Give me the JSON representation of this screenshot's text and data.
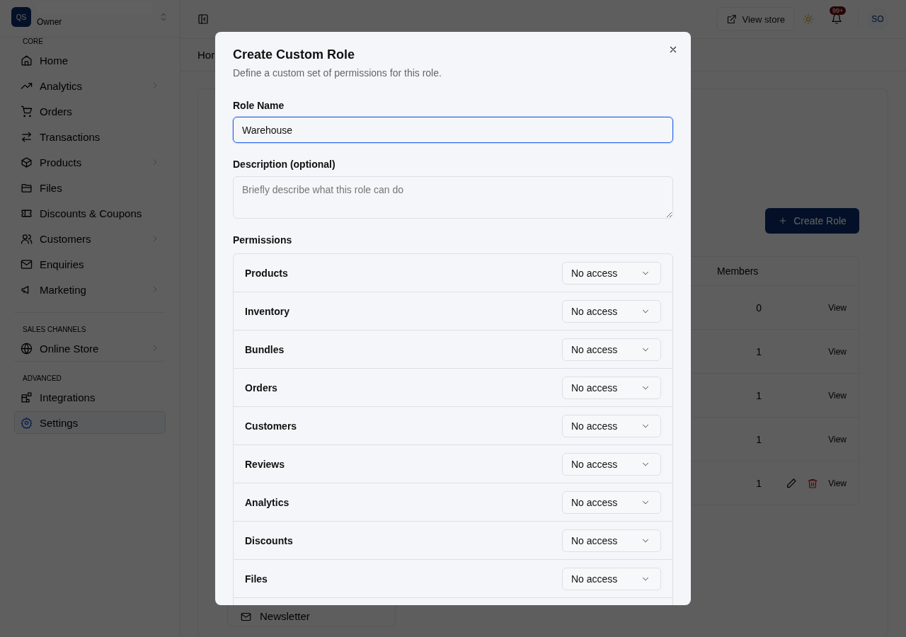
{
  "sidebar": {
    "brand": {
      "initials": "QS",
      "role": "Owner"
    },
    "sections": [
      {
        "label": "CORE",
        "items": [
          {
            "label": "Home",
            "has_children": false,
            "selected": false
          },
          {
            "label": "Analytics",
            "has_children": true,
            "selected": false
          },
          {
            "label": "Orders",
            "has_children": false,
            "selected": false
          },
          {
            "label": "Transactions",
            "has_children": false,
            "selected": false
          },
          {
            "label": "Products",
            "has_children": true,
            "selected": false
          },
          {
            "label": "Files",
            "has_children": false,
            "selected": false
          },
          {
            "label": "Discounts & Coupons",
            "has_children": false,
            "selected": false
          },
          {
            "label": "Customers",
            "has_children": true,
            "selected": false
          },
          {
            "label": "Enquiries",
            "has_children": false,
            "selected": false
          },
          {
            "label": "Marketing",
            "has_children": true,
            "selected": false
          }
        ]
      },
      {
        "label": "SALES CHANNELS",
        "items": [
          {
            "label": "Online Store",
            "has_children": true,
            "selected": false
          }
        ]
      },
      {
        "label": "ADVANCED",
        "items": [
          {
            "label": "Integrations",
            "has_children": false,
            "selected": false
          },
          {
            "label": "Settings",
            "has_children": false,
            "selected": true
          }
        ]
      }
    ]
  },
  "topbar": {
    "view_store": "View store",
    "notification_badge": "99+",
    "avatar": "SO"
  },
  "breadcrumb": "Hor",
  "roles_page": {
    "create_button": "Create Role",
    "table": {
      "columns": [
        "Members"
      ],
      "rows": [
        {
          "members": "0",
          "action": "View",
          "editable": false
        },
        {
          "members": "1",
          "action": "View",
          "editable": false
        },
        {
          "members": "1",
          "action": "View",
          "editable": false
        },
        {
          "members": "1",
          "action": "View",
          "editable": false
        },
        {
          "members": "1",
          "action": "View",
          "editable": true
        }
      ]
    },
    "settings_nav_item": "Newsletter"
  },
  "dialog": {
    "title": "Create Custom Role",
    "subtitle": "Define a custom set of permissions for this role.",
    "role_name": {
      "label": "Role Name",
      "value": "Warehouse"
    },
    "description": {
      "label": "Description (optional)",
      "placeholder": "Briefly describe what this role can do"
    },
    "permissions_label": "Permissions",
    "permissions": [
      {
        "name": "Products",
        "access": "No access"
      },
      {
        "name": "Inventory",
        "access": "No access"
      },
      {
        "name": "Bundles",
        "access": "No access"
      },
      {
        "name": "Orders",
        "access": "No access"
      },
      {
        "name": "Customers",
        "access": "No access"
      },
      {
        "name": "Reviews",
        "access": "No access"
      },
      {
        "name": "Analytics",
        "access": "No access"
      },
      {
        "name": "Discounts",
        "access": "No access"
      },
      {
        "name": "Files",
        "access": "No access"
      }
    ]
  }
}
